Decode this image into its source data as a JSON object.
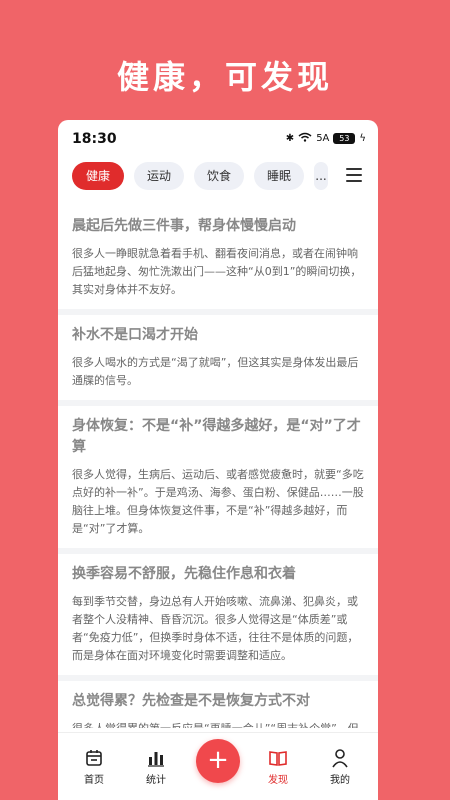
{
  "hero": {
    "title": "健康，可发现"
  },
  "status_bar": {
    "time": "18:30",
    "signal": "5A",
    "battery": "53"
  },
  "tabs": [
    {
      "label": "健康",
      "active": true
    },
    {
      "label": "运动",
      "active": false
    },
    {
      "label": "饮食",
      "active": false
    },
    {
      "label": "睡眠",
      "active": false
    },
    {
      "label": "...",
      "active": false
    }
  ],
  "articles": [
    {
      "title": "晨起后先做三件事，帮身体慢慢启动",
      "body": "很多人一睁眼就急着看手机、翻看夜间消息，或者在闹钟响后猛地起身、匆忙洗漱出门——这种“从0到1”的瞬间切换，其实对身体并不友好。"
    },
    {
      "title": "补水不是口渴才开始",
      "body": "很多人喝水的方式是“渴了就喝”，但这其实是身体发出最后通牒的信号。"
    },
    {
      "title": "身体恢复：不是“补”得越多越好，是“对”了才算",
      "body": "很多人觉得，生病后、运动后、或者感觉疲惫时，就要“多吃点好的补一补”。于是鸡汤、海参、蛋白粉、保健品……一股脑往上堆。但身体恢复这件事，不是“补”得越多越好，而是“对”了才算。"
    },
    {
      "title": "换季容易不舒服，先稳住作息和衣着",
      "body": "每到季节交替，身边总有人开始咳嗽、流鼻涕、犯鼻炎，或者整个人没精神、昏昏沉沉。很多人觉得这是“体质差”或者“免疫力低”，但换季时身体不适，往往不是体质的问题，而是身体在面对环境变化时需要调整和适应。"
    },
    {
      "title": "总觉得累？先检查是不是恢复方式不对",
      "body": "很多人觉得累的第一反应是“再睡一会儿”“周末补个觉”，但有时候，补觉越多反而越累。"
    }
  ],
  "bottom_nav": [
    {
      "label": "首页",
      "icon": "calendar-icon",
      "active": false
    },
    {
      "label": "统计",
      "icon": "bar-chart-icon",
      "active": false
    },
    {
      "label": "+",
      "icon": "plus-icon",
      "active": false
    },
    {
      "label": "发现",
      "icon": "book-icon",
      "active": true
    },
    {
      "label": "我的",
      "icon": "person-icon",
      "active": false
    }
  ],
  "colors": {
    "brand": "#e02c2c",
    "background": "#f06468",
    "fab": "#f0484c"
  }
}
